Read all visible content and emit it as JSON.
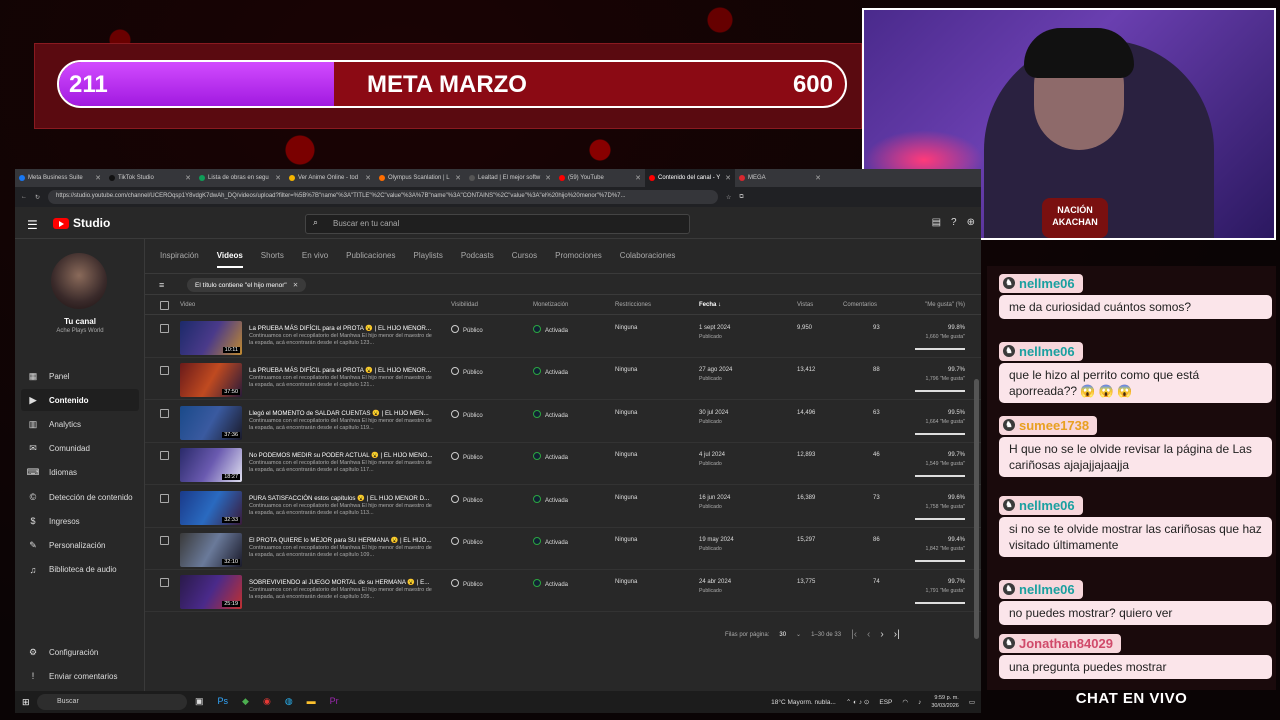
{
  "overlay": {
    "goal": {
      "current": "211",
      "title": "META MARZO",
      "target": "600",
      "fill_fraction": 0.35
    },
    "webcam_badge": "NACIÓN\nAKACHAN",
    "chat_title": "CHAT EN VIVO"
  },
  "browser": {
    "tabs": [
      {
        "label": "Meta Business Suite",
        "color": "#1877f2"
      },
      {
        "label": "TikTok Studio",
        "color": "#111111"
      },
      {
        "label": "Lista de obras en segu",
        "color": "#0f9d58"
      },
      {
        "label": "Ver Anime Online - tod",
        "color": "#f4b400"
      },
      {
        "label": "Olympus Scanlation | L",
        "color": "#ff6d00"
      },
      {
        "label": "Lealtad | El mejor softw",
        "color": "#555555"
      },
      {
        "label": "(59) YouTube",
        "color": "#ff0000"
      },
      {
        "label": "Contenido del canal - Y",
        "color": "#ff0000",
        "active": true
      },
      {
        "label": "MEGA",
        "color": "#d9272e"
      }
    ],
    "url": "https://studio.youtube.com/channel/UCEROqsp1Y8vdgK7dwAh_DQ/videos/upload?filter=%5B%7B\"name\"%3A\"TITLE\"%2C\"value\"%3A%7B\"name\"%3A\"CONTAINS\"%2C\"value\"%3A\"el%20hijo%20menor\"%7D%7..."
  },
  "studio": {
    "logo": "Studio",
    "search_placeholder": "Buscar en tu canal",
    "channel": {
      "name": "Tu canal",
      "subtitle": "Ache Plays World"
    },
    "nav": [
      {
        "label": "Panel",
        "icon": "dashboard-icon",
        "glyph": "▦"
      },
      {
        "label": "Contenido",
        "icon": "content-icon",
        "glyph": "▶",
        "active": true
      },
      {
        "label": "Analytics",
        "icon": "analytics-icon",
        "glyph": "▥"
      },
      {
        "label": "Comunidad",
        "icon": "community-icon",
        "glyph": "✉"
      },
      {
        "label": "Idiomas",
        "icon": "languages-icon",
        "glyph": "⌨"
      },
      {
        "label": "Detección de contenido",
        "icon": "copyright-icon",
        "glyph": "©"
      },
      {
        "label": "Ingresos",
        "icon": "earn-icon",
        "glyph": "$"
      },
      {
        "label": "Personalización",
        "icon": "customization-icon",
        "glyph": "✎"
      },
      {
        "label": "Biblioteca de audio",
        "icon": "audio-library-icon",
        "glyph": "♫"
      }
    ],
    "nav_bottom": [
      {
        "label": "Configuración",
        "icon": "settings-icon",
        "glyph": "⚙"
      },
      {
        "label": "Enviar comentarios",
        "icon": "feedback-icon",
        "glyph": "!"
      }
    ],
    "tabs": [
      "Inspiración",
      "Videos",
      "Shorts",
      "En vivo",
      "Publicaciones",
      "Playlists",
      "Podcasts",
      "Cursos",
      "Promociones",
      "Colaboraciones"
    ],
    "active_tab": "Videos",
    "filter_chip": "El título contiene \"el hijo menor\"",
    "columns": {
      "video": "Video",
      "visibility": "Visibilidad",
      "monetization": "Monetización",
      "restrictions": "Restricciones",
      "date": "Fecha ↓",
      "views": "Vistas",
      "comments": "Comentarios",
      "likes": "\"Me gusta\" (%)"
    },
    "videos": [
      {
        "title": "La PRUEBA MÁS DIFÍCIL para el PROTA 😮 | EL HIJO MENOR...",
        "desc": "Continuamos con el recopilatorio del Manhwa El hijo menor del maestro de la espada, acá encontrarán desde el capítulo 123...",
        "duration": "10:11",
        "visibility": "Público",
        "monetization": "Activada",
        "restrictions": "Ninguna",
        "date": "1 sept 2024",
        "status": "Publicado",
        "views": "9,950",
        "comments": "93",
        "likes_pct": "99.8%",
        "likes_count": "1,660 \"Me gusta\"",
        "likes_fraction": 0.998
      },
      {
        "title": "La PRUEBA MÁS DIFÍCIL para el PROTA 😮 | EL HIJO MENOR...",
        "desc": "Continuamos con el recopilatorio del Manhwa El hijo menor del maestro de la espada, acá encontrarán desde el capítulo 121...",
        "duration": "37:50",
        "visibility": "Público",
        "monetization": "Activada",
        "restrictions": "Ninguna",
        "date": "27 ago 2024",
        "status": "Publicado",
        "views": "13,412",
        "comments": "88",
        "likes_pct": "99.7%",
        "likes_count": "1,796 \"Me gusta\"",
        "likes_fraction": 0.997
      },
      {
        "title": "Llegó el MOMENTO de SALDAR CUENTAS 😮 | EL HIJO MEN...",
        "desc": "Continuamos con el recopilatorio del Manhwa El hijo menor del maestro de la espada, acá encontrarán desde el capítulo 119...",
        "duration": "37:36",
        "visibility": "Público",
        "monetization": "Activada",
        "restrictions": "Ninguna",
        "date": "30 jul 2024",
        "status": "Publicado",
        "views": "14,496",
        "comments": "63",
        "likes_pct": "99.5%",
        "likes_count": "1,664 \"Me gusta\"",
        "likes_fraction": 0.995
      },
      {
        "title": "No PODEMOS MEDIR su PODER ACTUAL 😮 | EL HIJO MENO...",
        "desc": "Continuamos con el recopilatorio del Manhwa El hijo menor del maestro de la espada, acá encontrarán desde el capítulo 117...",
        "duration": "18:27",
        "visibility": "Público",
        "monetization": "Activada",
        "restrictions": "Ninguna",
        "date": "4 jul 2024",
        "status": "Publicado",
        "views": "12,893",
        "comments": "46",
        "likes_pct": "99.7%",
        "likes_count": "1,549 \"Me gusta\"",
        "likes_fraction": 0.997
      },
      {
        "title": "PURA SATISFACCIÓN estos capítulos 😮 | EL HIJO MENOR D...",
        "desc": "Continuamos con el recopilatorio del Manhwa El hijo menor del maestro de la espada, acá encontrarán desde el capítulo 113...",
        "duration": "32:33",
        "visibility": "Público",
        "monetization": "Activada",
        "restrictions": "Ninguna",
        "date": "16 jun 2024",
        "status": "Publicado",
        "views": "16,389",
        "comments": "73",
        "likes_pct": "99.6%",
        "likes_count": "1,758 \"Me gusta\"",
        "likes_fraction": 0.996
      },
      {
        "title": "El PROTA QUIERE lo MEJOR para SU HERMANA 😮 | EL HIJO...",
        "desc": "Continuamos con el recopilatorio del Manhwa El hijo menor del maestro de la espada, acá encontrarán desde el capítulo 109...",
        "duration": "32:10",
        "visibility": "Público",
        "monetization": "Activada",
        "restrictions": "Ninguna",
        "date": "19 may 2024",
        "status": "Publicado",
        "views": "15,297",
        "comments": "86",
        "likes_pct": "99.4%",
        "likes_count": "1,842 \"Me gusta\"",
        "likes_fraction": 0.994
      },
      {
        "title": "SOBREVIVIENDO al JUEGO MORTAL de su HERMANA 😮 | E...",
        "desc": "Continuamos con el recopilatorio del Manhwa El hijo menor del maestro de la espada, acá encontrarán desde el capítulo 105...",
        "duration": "25:19",
        "visibility": "Público",
        "monetization": "Activada",
        "restrictions": "Ninguna",
        "date": "24 abr 2024",
        "status": "Publicado",
        "views": "13,775",
        "comments": "74",
        "likes_pct": "99.7%",
        "likes_count": "1,791 \"Me gusta\"",
        "likes_fraction": 0.997
      }
    ],
    "pagination": {
      "rows_label": "Filas por página:",
      "rows_value": "30",
      "range": "1–30 de 33"
    }
  },
  "taskbar": {
    "search": "Buscar",
    "weather": "18°C  Mayorm. nubla...",
    "lang": "ESP",
    "time": "9:59 p. m.",
    "date": "30/03/2026"
  },
  "chat": [
    {
      "user": "nellme06",
      "text": "me da curiosidad cuántos somos?"
    },
    {
      "user": "nellme06",
      "text": "que le hizo al perrito como que está aporreada?? 😱 😱 😱"
    },
    {
      "user": "sumee1738",
      "text": "H que no se le olvide revisar la página de Las cariñosas ajajajjajaajja",
      "user_color": "#e8a020"
    },
    {
      "user": "nellme06",
      "text": "si no se te olvide mostrar las cariñosas que haz visitado últimamente"
    },
    {
      "user": "nellme06",
      "text": "no puedes mostrar? quiero ver"
    },
    {
      "user": "Jonathan84029",
      "text": "una pregunta puedes mostrar",
      "user_color": "#d04a6a"
    }
  ]
}
